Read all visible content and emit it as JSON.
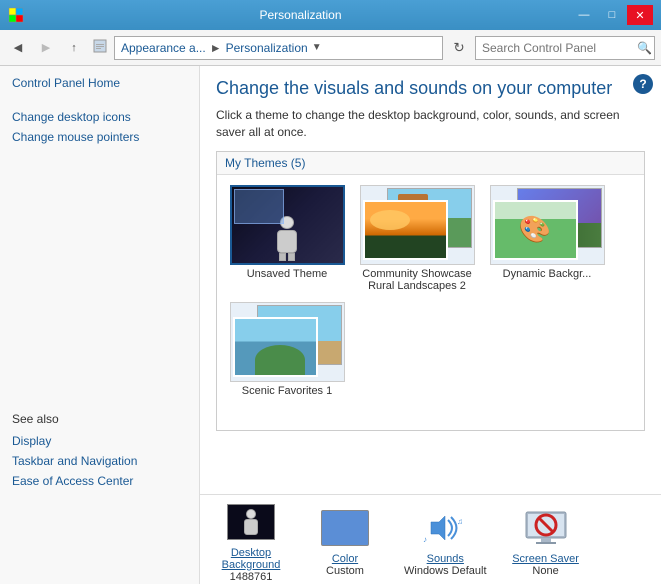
{
  "titleBar": {
    "title": "Personalization",
    "icon": "⚙",
    "minBtn": "—",
    "maxBtn": "□",
    "closeBtn": "✕"
  },
  "navBar": {
    "backBtn": "◀",
    "forwardBtn": "▶",
    "upBtn": "↑",
    "breadcrumb": {
      "part1": "Appearance a...",
      "sep1": "▶",
      "part2": "Personalization",
      "arrowLabel": "▼"
    },
    "refreshBtn": "↻",
    "searchPlaceholder": "Search Control Panel",
    "searchIcon": "🔍"
  },
  "helpBtn": "?",
  "sidebar": {
    "links": [
      {
        "label": "Control Panel Home",
        "name": "control-panel-home"
      },
      {
        "label": "Change desktop icons",
        "name": "change-desktop-icons"
      },
      {
        "label": "Change mouse pointers",
        "name": "change-mouse-pointers"
      }
    ],
    "seeAlso": "See also",
    "seeAlsoLinks": [
      {
        "label": "Display",
        "name": "display-link"
      },
      {
        "label": "Taskbar and Navigation",
        "name": "taskbar-link"
      },
      {
        "label": "Ease of Access Center",
        "name": "ease-of-access-link"
      }
    ]
  },
  "content": {
    "title": "Change the visuals and sounds on your computer",
    "description": "Click a theme to change the desktop background, color, sounds, and screen saver all at once.",
    "themesPanel": {
      "header": "My Themes (5)",
      "themes": [
        {
          "name": "Unsaved Theme",
          "selected": true
        },
        {
          "name": "Community Showcase\nRural Landscapes 2",
          "selected": false
        },
        {
          "name": "Dynamic Backgr...",
          "selected": false
        },
        {
          "name": "Scenic Favorites 1",
          "selected": false
        }
      ]
    }
  },
  "bottomBar": {
    "items": [
      {
        "label": "Desktop\nBackground",
        "sub": "1488761",
        "name": "desktop-background"
      },
      {
        "label": "Color",
        "sub": "Custom",
        "name": "color"
      },
      {
        "label": "Sounds",
        "sub": "Windows Default",
        "name": "sounds"
      },
      {
        "label": "Screen Saver",
        "sub": "None",
        "name": "screen-saver"
      }
    ]
  }
}
